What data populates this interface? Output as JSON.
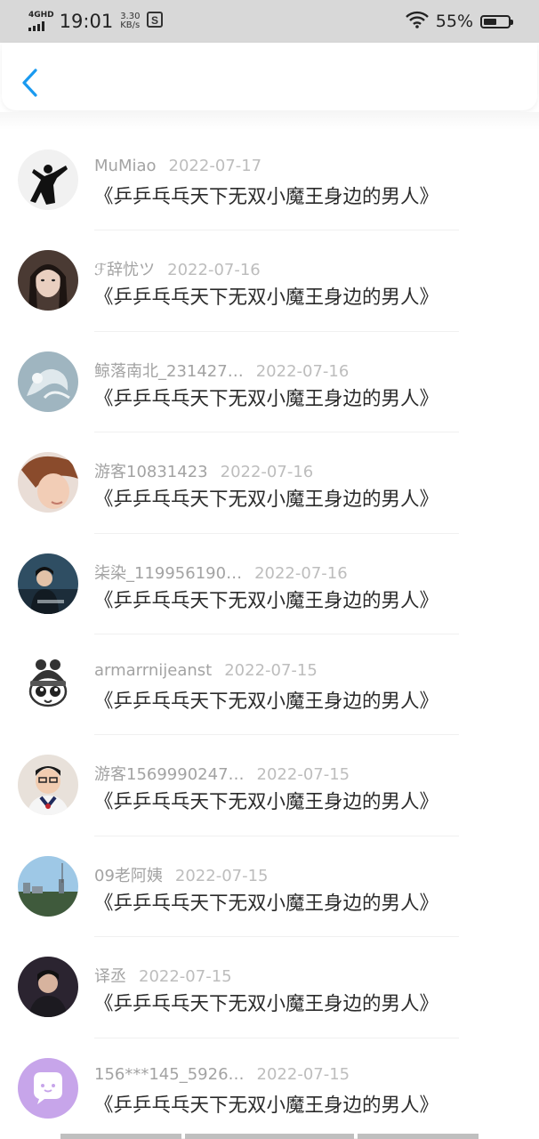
{
  "status_bar": {
    "network": "4GHD",
    "time": "19:01",
    "speed_value": "3.30",
    "speed_unit": "KB/s",
    "app_icon": "S",
    "battery_percent": "55%",
    "battery_level": 0.55
  },
  "comments": [
    {
      "user": "MuMiao",
      "date": "2022-07-17",
      "text": "《乒乒乓乓天下无双小魔王身边的男人》"
    },
    {
      "user": "ℱ辞忧ツ",
      "date": "2022-07-16",
      "text": "《乒乒乓乓天下无双小魔王身边的男人》"
    },
    {
      "user": "鲸落南北_231427…",
      "date": "2022-07-16",
      "text": "《乒乒乓乓天下无双小魔王身边的男人》"
    },
    {
      "user": "游客10831423",
      "date": "2022-07-16",
      "text": "《乒乒乓乓天下无双小魔王身边的男人》"
    },
    {
      "user": "柒染_119956190…",
      "date": "2022-07-16",
      "text": "《乒乒乓乓天下无双小魔王身边的男人》"
    },
    {
      "user": "armarrnijeanst",
      "date": "2022-07-15",
      "text": "《乒乒乓乓天下无双小魔王身边的男人》"
    },
    {
      "user": "游客1569990247…",
      "date": "2022-07-15",
      "text": "《乒乒乓乓天下无双小魔王身边的男人》"
    },
    {
      "user": "09老阿姨",
      "date": "2022-07-15",
      "text": "《乒乒乓乓天下无双小魔王身边的男人》"
    },
    {
      "user": "译丞",
      "date": "2022-07-15",
      "text": "《乒乒乓乓天下无双小魔王身边的男人》"
    },
    {
      "user": "156***145_5926…",
      "date": "2022-07-15",
      "text": "《乒乒乓乓天下无双小魔王身边的男人》"
    }
  ],
  "colors": {
    "accent": "#1a9af0",
    "status_bar_bg": "#d8d8d8",
    "meta_text": "#a3a3a3",
    "date_text": "#bdbdbd",
    "title_text": "#2a2a2a",
    "default_avatar_bg": "#c7a5ea"
  }
}
